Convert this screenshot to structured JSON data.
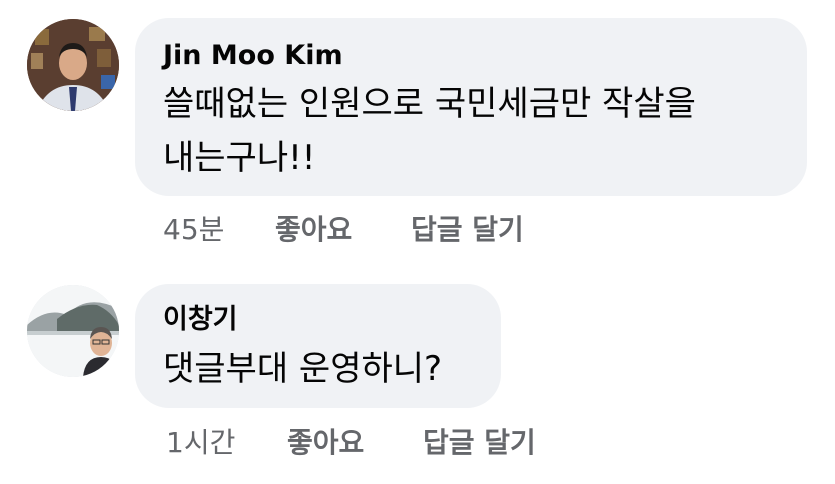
{
  "comments": [
    {
      "author": "Jin Moo Kim",
      "text_lines": [
        "쓸때없는 인원으로 국민세금만 작살을",
        "내는구나!!"
      ],
      "time": "45분",
      "like_label": "좋아요",
      "reply_label": "답글 달기",
      "avatar_icon": "profile-photo-icon"
    },
    {
      "author": "이창기",
      "text_lines": [
        "댓글부대 운영하니?"
      ],
      "time": "1시간",
      "like_label": "좋아요",
      "reply_label": "답글 달기",
      "avatar_icon": "profile-photo-icon"
    }
  ],
  "colors": {
    "bubble": "#f0f2f5",
    "meta_text": "#65676b",
    "text": "#050505"
  }
}
